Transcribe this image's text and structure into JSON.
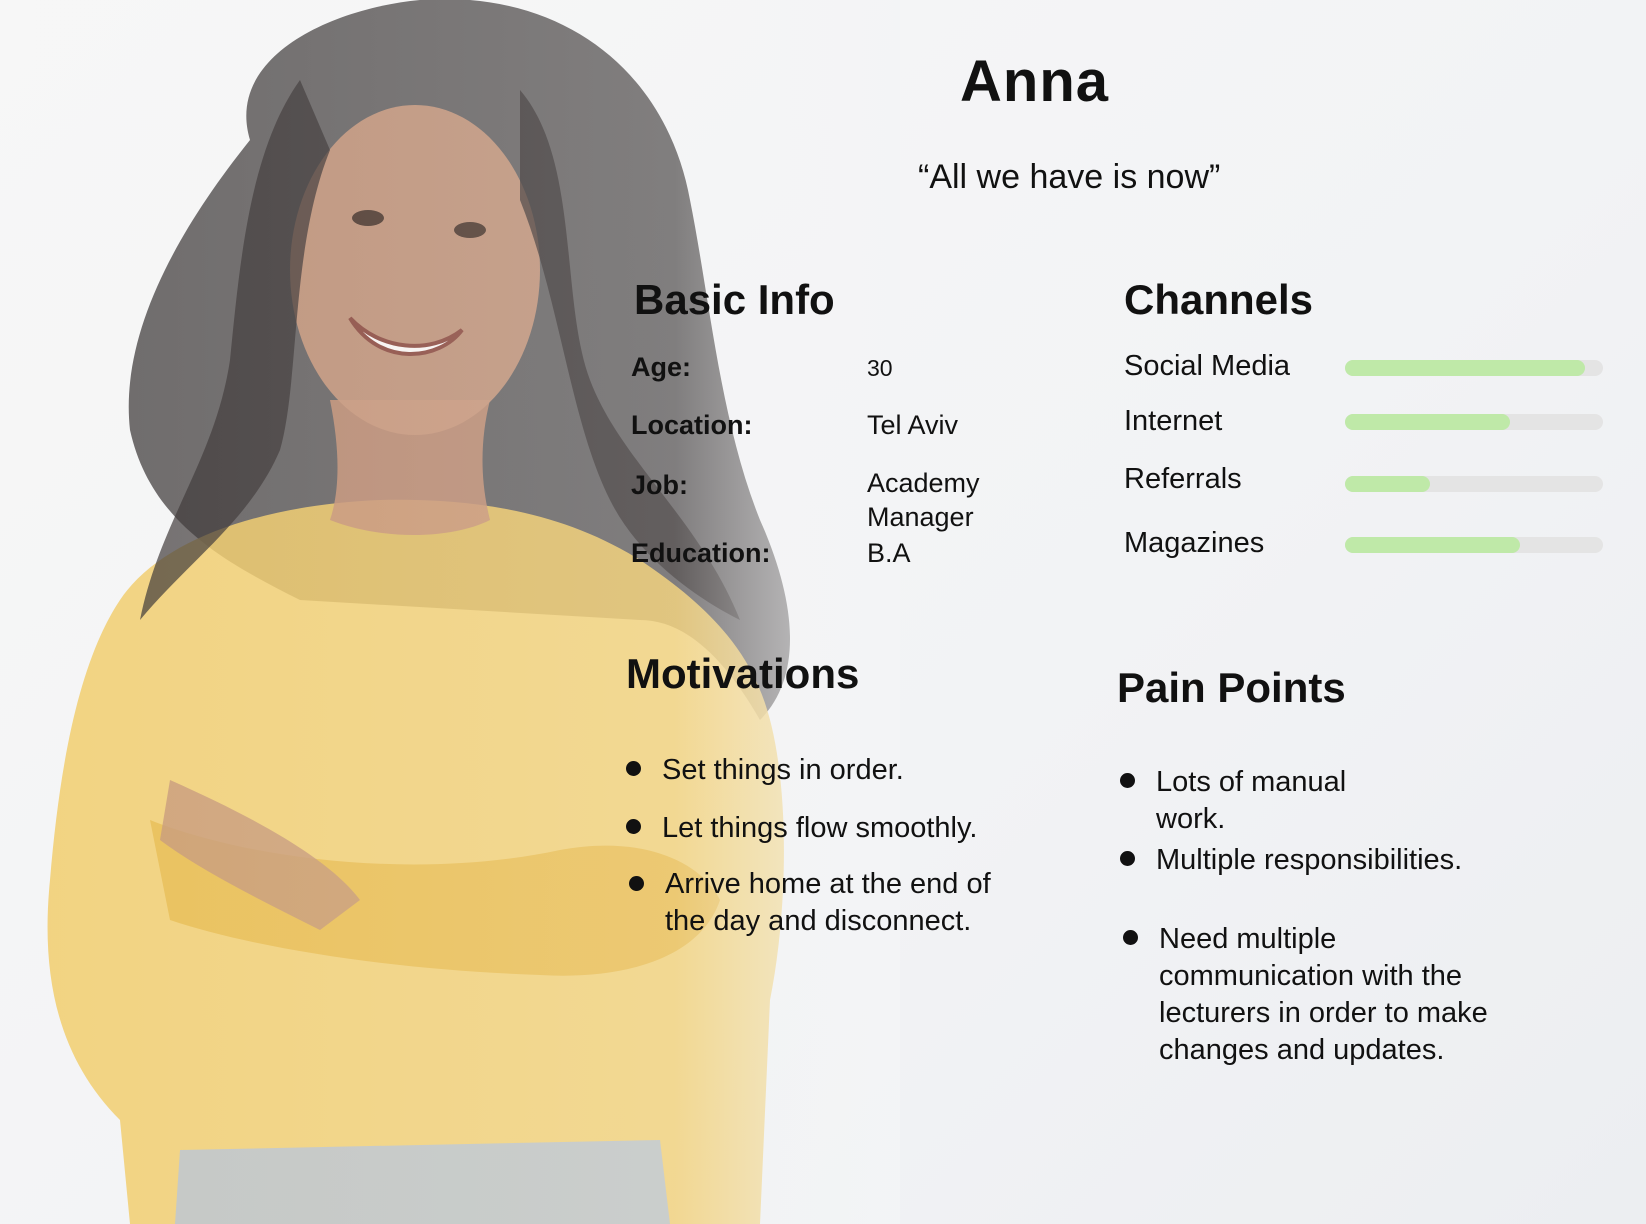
{
  "persona": {
    "name": "Anna",
    "quote": "“All we have is now”"
  },
  "basic_info": {
    "title": "Basic  Info",
    "rows": [
      {
        "label": "Age:",
        "value": "30"
      },
      {
        "label": "Location:",
        "value": "Tel Aviv"
      },
      {
        "label": "Job:",
        "value": "Academy Manager"
      },
      {
        "label": "Education:",
        "value": "B.A"
      }
    ]
  },
  "channels": {
    "title": "Channels",
    "items": [
      {
        "name": "Social Media",
        "level": 0.93
      },
      {
        "name": "Internet",
        "level": 0.64
      },
      {
        "name": "Referrals",
        "level": 0.33
      },
      {
        "name": "Magazines",
        "level": 0.68
      }
    ],
    "bar_color": "#bfe9a8",
    "track_color": "#e4e4e4"
  },
  "motivations": {
    "title": "Motivations",
    "items": [
      "Set things in order.",
      "Let things flow smoothly.",
      "Arrive home at the end of the day and disconnect."
    ]
  },
  "pain_points": {
    "title": "Pain  Points",
    "items": [
      "Lots of manual work.",
      "Multiple responsibilities.",
      "Need multiple communication with the lecturers in order to make changes and updates."
    ]
  }
}
